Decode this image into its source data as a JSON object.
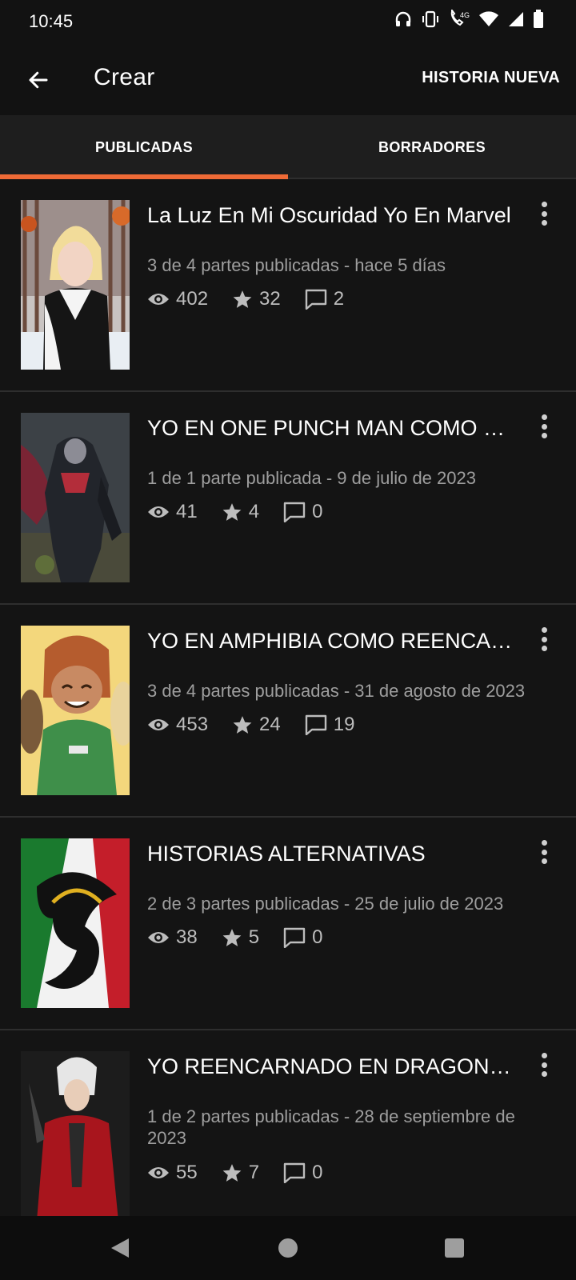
{
  "status_bar": {
    "time": "10:45",
    "network": "4G"
  },
  "app_bar": {
    "title": "Crear",
    "action_label": "HISTORIA NUEVA"
  },
  "tabs": [
    {
      "label": "PUBLICADAS",
      "active": true
    },
    {
      "label": "BORRADORES",
      "active": false
    }
  ],
  "accent_color": "#ef6a36",
  "stories": [
    {
      "title": "La Luz En Mi Oscuridad Yo En Marvel",
      "meta": "3 de 4 partes publicadas - hace 5 días",
      "views": "402",
      "votes": "32",
      "comments": "2"
    },
    {
      "title": "YO  EN ONE PUNCH MAN COMO UN VILLANO",
      "meta": "1 de 1 parte publicada - 9 de julio de 2023",
      "views": "41",
      "votes": "4",
      "comments": "0"
    },
    {
      "title": "YO EN AMPHIBIA COMO REENCARNADO",
      "meta": "3 de 4 partes publicadas - 31 de agosto de 2023",
      "views": "453",
      "votes": "24",
      "comments": "19"
    },
    {
      "title": "HISTORIAS ALTERNATIVAS",
      "meta": "2 de 3 partes publicadas - 25 de julio de 2023",
      "views": "38",
      "votes": "5",
      "comments": "0"
    },
    {
      "title": "YO REENCARNADO EN DRAGON BALL",
      "meta": "1 de 2 partes publicadas - 28 de septiembre de 2023",
      "views": "55",
      "votes": "7",
      "comments": "0"
    }
  ]
}
